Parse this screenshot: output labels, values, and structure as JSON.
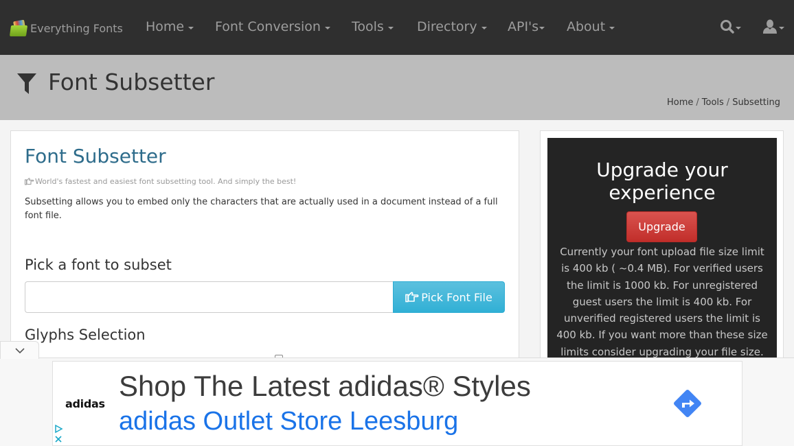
{
  "navbar": {
    "brand": "Everything Fonts",
    "items": [
      {
        "label": "Home"
      },
      {
        "label": "Font Conversion"
      },
      {
        "label": "Tools"
      },
      {
        "label": "Directory"
      },
      {
        "label": "API's"
      },
      {
        "label": "About"
      }
    ],
    "icons": [
      "search-icon",
      "user-icon"
    ]
  },
  "header": {
    "title": "Font Subsetter",
    "icon": "filter-icon",
    "breadcrumb": [
      "Home",
      "Tools",
      "Subsetting"
    ],
    "breadcrumb_separator": "/"
  },
  "main": {
    "title": "Font Subsetter",
    "tagline": "World's fastest and easiest font subsetting tool. And simply the best!",
    "description": "Subsetting allows you to embed only the characters that are actually used in a document instead of a full font file.",
    "pick_heading": "Pick a font to subset",
    "font_input_value": "",
    "pick_button": "Pick Font File",
    "glyphs_heading": "Glyphs Selection"
  },
  "sidebar": {
    "upgrade_title": "Upgrade your experience",
    "upgrade_button": "Upgrade",
    "upgrade_text": "Currently your font upload file size limit is 400 kb ( ~0.4 MB). For verified users the limit is 1000 kb. For unregistered guest users the limit is 400 kb. For unverified registered users the limit is 400 kb. If you want more than these size limits consider upgrading your file size."
  },
  "ad": {
    "brand": "adidas",
    "headline": "Shop The Latest adidas® Styles",
    "subline": "adidas Outlet Store Leesburg",
    "colors": {
      "headline": "#3c3c3c",
      "subline": "#1a73e8",
      "arrow": "#4285f4"
    }
  },
  "colors": {
    "navbar_bg": "#2f2f2f",
    "header_bg": "#bcbcbc",
    "title_blue": "#2e6c8b",
    "info_button": "#5bc0de",
    "danger_button": "#d9534f",
    "upgrade_bg": "#242424"
  }
}
